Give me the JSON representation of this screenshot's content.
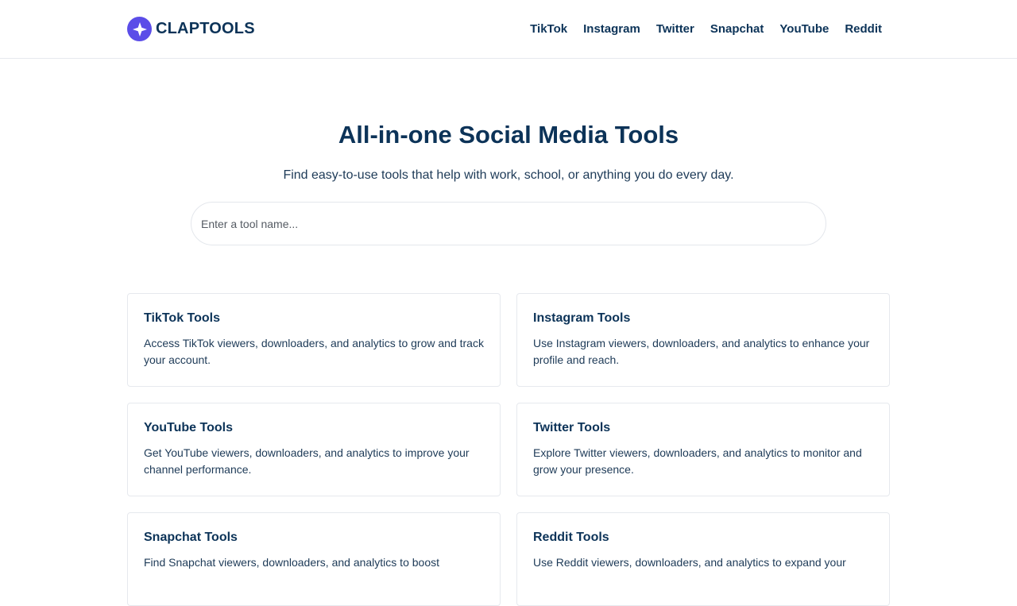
{
  "brand": {
    "name": "CLAPTOOLS",
    "accent": "#5b4de8",
    "text_color": "#0c3358"
  },
  "nav": {
    "links": [
      "TikTok",
      "Instagram",
      "Twitter",
      "Snapchat",
      "YouTube",
      "Reddit"
    ]
  },
  "hero": {
    "title": "All-in-one Social Media Tools",
    "subtitle": "Find easy-to-use tools that help with work, school, or anything you do every day."
  },
  "search": {
    "placeholder": "Enter a tool name..."
  },
  "cards": [
    {
      "title": "TikTok Tools",
      "description": "Access TikTok viewers, downloaders, and analytics to grow and track your account."
    },
    {
      "title": "Instagram Tools",
      "description": "Use Instagram viewers, downloaders, and analytics to enhance your profile and reach."
    },
    {
      "title": "YouTube Tools",
      "description": "Get YouTube viewers, downloaders, and analytics to improve your channel performance."
    },
    {
      "title": "Twitter Tools",
      "description": "Explore Twitter viewers, downloaders, and analytics to monitor and grow your presence."
    },
    {
      "title": "Snapchat Tools",
      "description": "Find Snapchat viewers, downloaders, and analytics to boost"
    },
    {
      "title": "Reddit Tools",
      "description": "Use Reddit viewers, downloaders, and analytics to expand your"
    }
  ]
}
